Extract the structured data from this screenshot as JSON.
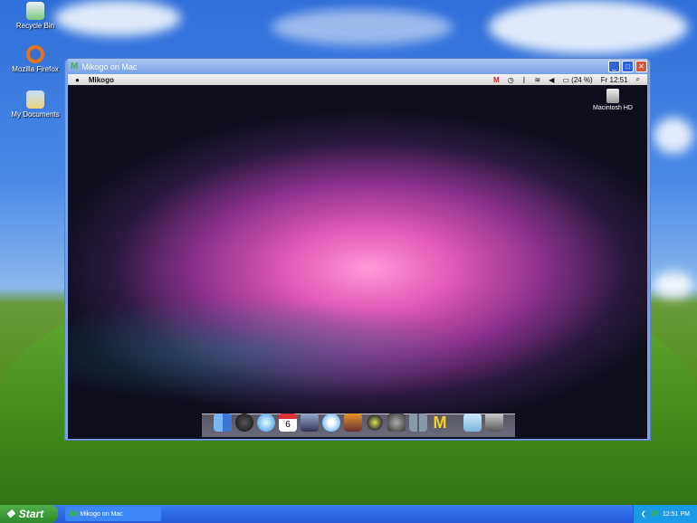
{
  "desktop_icons": [
    {
      "label": "Recycle Bin",
      "icon": "recycle-bin-icon"
    },
    {
      "label": "Mozilla Firefox",
      "icon": "firefox-icon"
    },
    {
      "label": "My Documents",
      "icon": "my-documents-icon"
    }
  ],
  "window": {
    "title": "Mikogo on Mac",
    "buttons": [
      "minimize",
      "maximize",
      "close"
    ]
  },
  "mac_menubar": {
    "app": "Mikogo",
    "battery": "(24 %)",
    "clock": "Fr 12:51",
    "status_icons": [
      "mikogo",
      "time-machine",
      "bluetooth",
      "wifi",
      "volume",
      "battery",
      "spotlight"
    ]
  },
  "mac_desktop": {
    "drive_label": "Macintosh HD"
  },
  "dock": {
    "items": [
      "Finder",
      "Dashboard",
      "Safari",
      "iCal",
      "iPhoto",
      "iTunes",
      "Photo Booth",
      "iMovie",
      "Time Machine",
      "Spaces",
      "Mikogo",
      "Documents",
      "Trash"
    ],
    "date": "6"
  },
  "taskbar": {
    "start": "Start",
    "task": "Mikogo on Mac",
    "clock": "12:51 PM"
  }
}
